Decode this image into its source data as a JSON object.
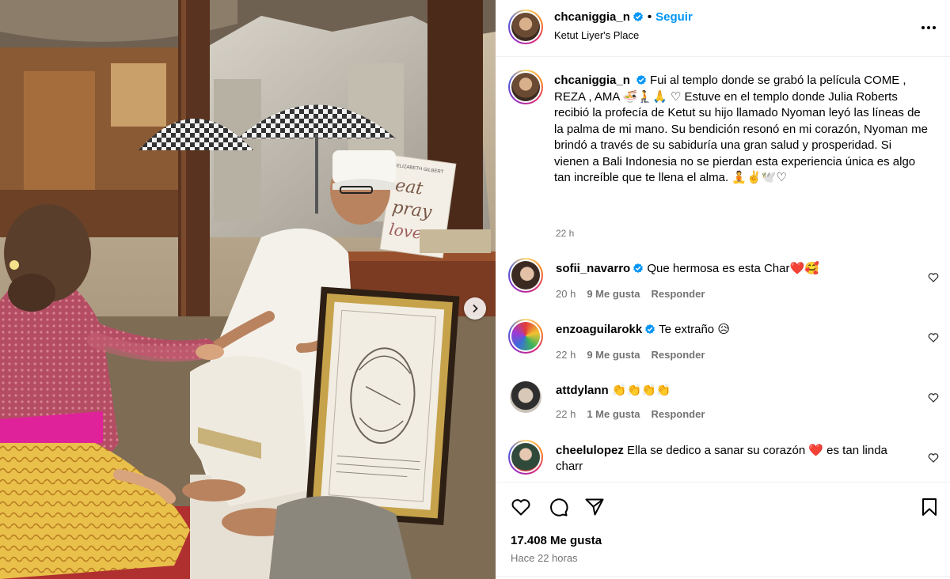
{
  "post": {
    "author": "chcaniggia_n",
    "separator": "•",
    "follow_label": "Seguir",
    "location": "Ketut Liyer's Place",
    "caption": "Fui al templo donde se grabó la película COME , REZA , AMA 🍜🧎🙏 ♡ Estuve en el templo donde Julia Roberts recibió la profecía de Ketut su hijo llamado Nyoman leyó las líneas de la palma de mi mano. Su bendición resonó en mi corazón, Nyoman me brindó a través de su sabiduría una gran salud y prosperidad. Si vienen a Bali Indonesia no se pierdan esta experiencia única es algo tan increíble que te llena el alma. 🧘✌️🕊️♡",
    "caption_time": "22 h",
    "likes": "17.408 Me gusta",
    "posted": "Hace 22 horas"
  },
  "photo": {
    "book_text_1": "eat",
    "book_text_2": "pray",
    "book_text_3": "love",
    "book_author": "ELIZABETH GILBERT"
  },
  "comments": [
    {
      "user": "sofii_navarro",
      "verified": true,
      "text": "Que hermosa es esta Char❤️🥰",
      "time": "20 h",
      "likes": "9 Me gusta",
      "reply": "Responder"
    },
    {
      "user": "enzoaguilarokk",
      "verified": true,
      "text": "Te extraño 😥",
      "time": "22 h",
      "likes": "9 Me gusta",
      "reply": "Responder"
    },
    {
      "user": "attdylann",
      "verified": false,
      "text": "👏👏👏👏",
      "time": "22 h",
      "likes": "1 Me gusta",
      "reply": "Responder"
    },
    {
      "user": "cheelulopez",
      "verified": false,
      "text": "Ella se dedico a sanar su corazón ❤️ es tan linda charr",
      "time": "",
      "likes": "",
      "reply": ""
    }
  ],
  "icons": {
    "more": "more-options-icon",
    "verified": "verified-badge-icon",
    "like": "heart-icon",
    "comment": "comment-bubble-icon",
    "share": "paper-plane-icon",
    "save": "bookmark-icon",
    "next": "chevron-right-icon"
  },
  "colors": {
    "link": "#0095f6",
    "verified": "#0095f6",
    "muted": "#737373",
    "accent_sash": "#e0229a",
    "blouse": "#b04a60"
  }
}
